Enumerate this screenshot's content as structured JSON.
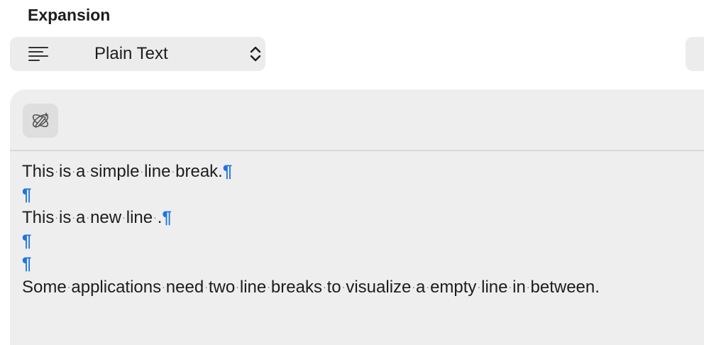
{
  "section": {
    "title": "Expansion"
  },
  "format_select": {
    "icon": "text-align-left-icon",
    "selected": "Plain Text",
    "chevron_icon": "chevron-up-down-icon"
  },
  "toolbar": {
    "ai_button_icon": "ai-writing-tools-icon"
  },
  "editor": {
    "lines": [
      {
        "words": [
          "This",
          "is",
          "a",
          "simple",
          "line",
          "break."
        ],
        "pilcrow": "¶"
      },
      {
        "words": [],
        "pilcrow": "¶"
      },
      {
        "words": [
          "This",
          "is",
          "a",
          "new",
          "line",
          "."
        ],
        "pilcrow": "¶"
      },
      {
        "words": [],
        "pilcrow": "¶"
      },
      {
        "words": [],
        "pilcrow": "¶"
      },
      {
        "words": [
          "Some",
          "applications",
          "need",
          "two",
          "line",
          "breaks",
          "to",
          "visualize",
          "a",
          "empty",
          "line",
          "in",
          "between."
        ],
        "pilcrow": ""
      }
    ],
    "space_marker": "·",
    "invisible_marker_color": "#1d74e0"
  }
}
